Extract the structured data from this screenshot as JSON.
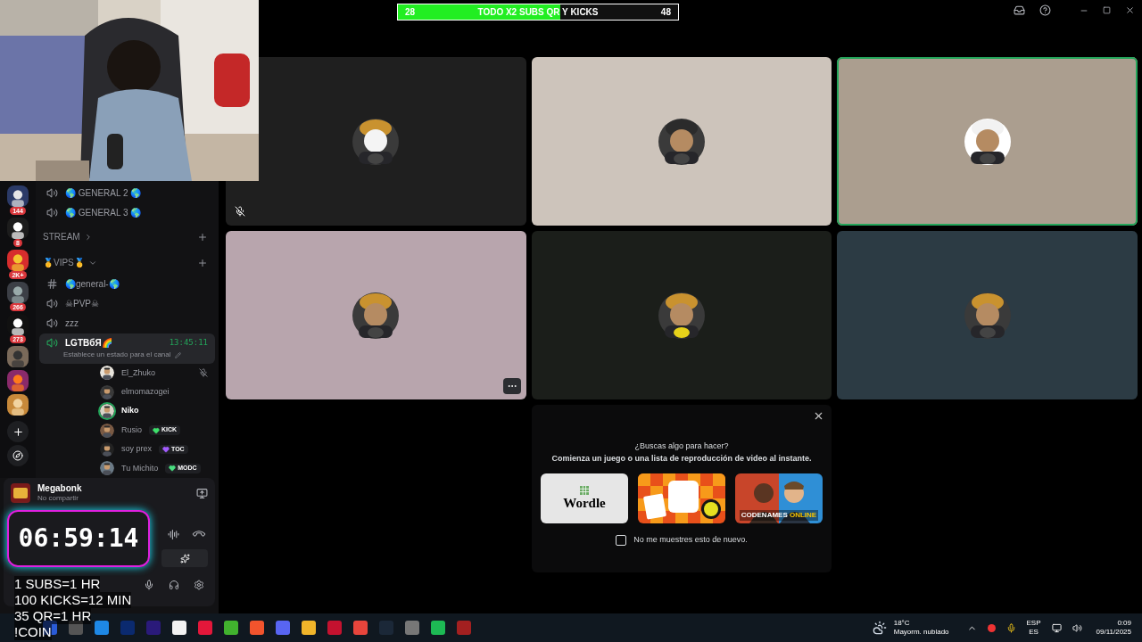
{
  "top_bar": {
    "goal": {
      "start": "28",
      "label": "TODO X2 SUBS QR Y KICKS",
      "end": "48",
      "level": 0.58
    }
  },
  "servers": [
    {
      "kind": "picture",
      "badge": "144"
    },
    {
      "kind": "picture",
      "badge": "8"
    },
    {
      "kind": "picture",
      "badge": "2K+"
    },
    {
      "kind": "picture",
      "badge": "266"
    },
    {
      "kind": "picture",
      "badge": "273"
    },
    {
      "kind": "picture"
    },
    {
      "kind": "picture"
    },
    {
      "kind": "picture"
    }
  ],
  "channels": [
    {
      "kind": "voice",
      "name": "🌎 GENERAL 2 🌎",
      "selected": false
    },
    {
      "kind": "voice",
      "name": "🌎 GENERAL 3 🌎",
      "selected": false
    },
    {
      "kind": "category",
      "name": "STREAM",
      "expanded": false
    },
    {
      "kind": "category",
      "name": "🥇VIPS🥇",
      "expanded": true
    },
    {
      "kind": "text",
      "name": "🌎general-🌎",
      "selected": false
    },
    {
      "kind": "voice",
      "name": "☠PVP☠",
      "selected": false
    },
    {
      "kind": "voice",
      "name": "zzz",
      "selected": false
    },
    {
      "kind": "voice",
      "name": "LGTBбЯ🌈",
      "selected": true,
      "timer": "13:45:11",
      "status": "Establece un estado para el canal",
      "members": [
        {
          "name": "El_Zhuko",
          "speaking": false,
          "muted": true
        },
        {
          "name": "elmomazogei",
          "speaking": false,
          "muted": false
        },
        {
          "name": "Niko",
          "speaking": true,
          "muted": false
        },
        {
          "name": "Rusio",
          "speaking": false,
          "muted": false,
          "tag": {
            "text": "KICK",
            "color": "#3ee06b"
          }
        },
        {
          "name": "soy prex",
          "speaking": false,
          "muted": false,
          "tag": {
            "text": "TOC",
            "color": "#a35cff"
          }
        },
        {
          "name": "Tu Michito",
          "speaking": false,
          "muted": false,
          "tag": {
            "text": "MODC",
            "color": "#4ade80"
          }
        }
      ]
    }
  ],
  "voice_panel": {
    "activity": "Megabonk",
    "activity_status": "No compartir"
  },
  "timer_overlay": "06:59:14",
  "rules_overlay": [
    "1 SUBS=1 HR",
    "100 KICKS=12 MIN",
    "35 QR=1 HR",
    "!COIN"
  ],
  "tiles": [
    {
      "color": "#1f1f1f",
      "speaking": false,
      "muted": true,
      "hovered": false
    },
    {
      "color": "#cdc4bb",
      "speaking": false,
      "muted": false,
      "hovered": false
    },
    {
      "color": "#ab9e8f",
      "speaking": true,
      "muted": false,
      "hovered": false
    },
    {
      "color": "#b8a5ad",
      "speaking": false,
      "muted": false,
      "hovered": true
    },
    {
      "color": "#1b1e1a",
      "speaking": false,
      "muted": false,
      "hovered": false
    },
    {
      "color": "#2c3b44",
      "speaking": false,
      "muted": false,
      "hovered": false
    }
  ],
  "activity_prompt": {
    "title": "¿Buscas algo para hacer?",
    "subtitle": "Comienza un juego o una lista de reproducción de video al instante.",
    "games": [
      {
        "kind": "wordle",
        "title": "Wordle"
      },
      {
        "kind": "picture"
      },
      {
        "kind": "codenames",
        "title": "CODENAMES",
        "title_accent": "ONLINE"
      }
    ],
    "dont_show": {
      "label": "No me muestres esto de nuevo.",
      "checked": false
    }
  },
  "taskbar": {
    "weather": {
      "temp": "18°C",
      "text": "Mayorm. nublado"
    },
    "language": [
      "ESP",
      "ES"
    ],
    "clock": {
      "time": "0:09",
      "date": "09/11/2025"
    }
  }
}
